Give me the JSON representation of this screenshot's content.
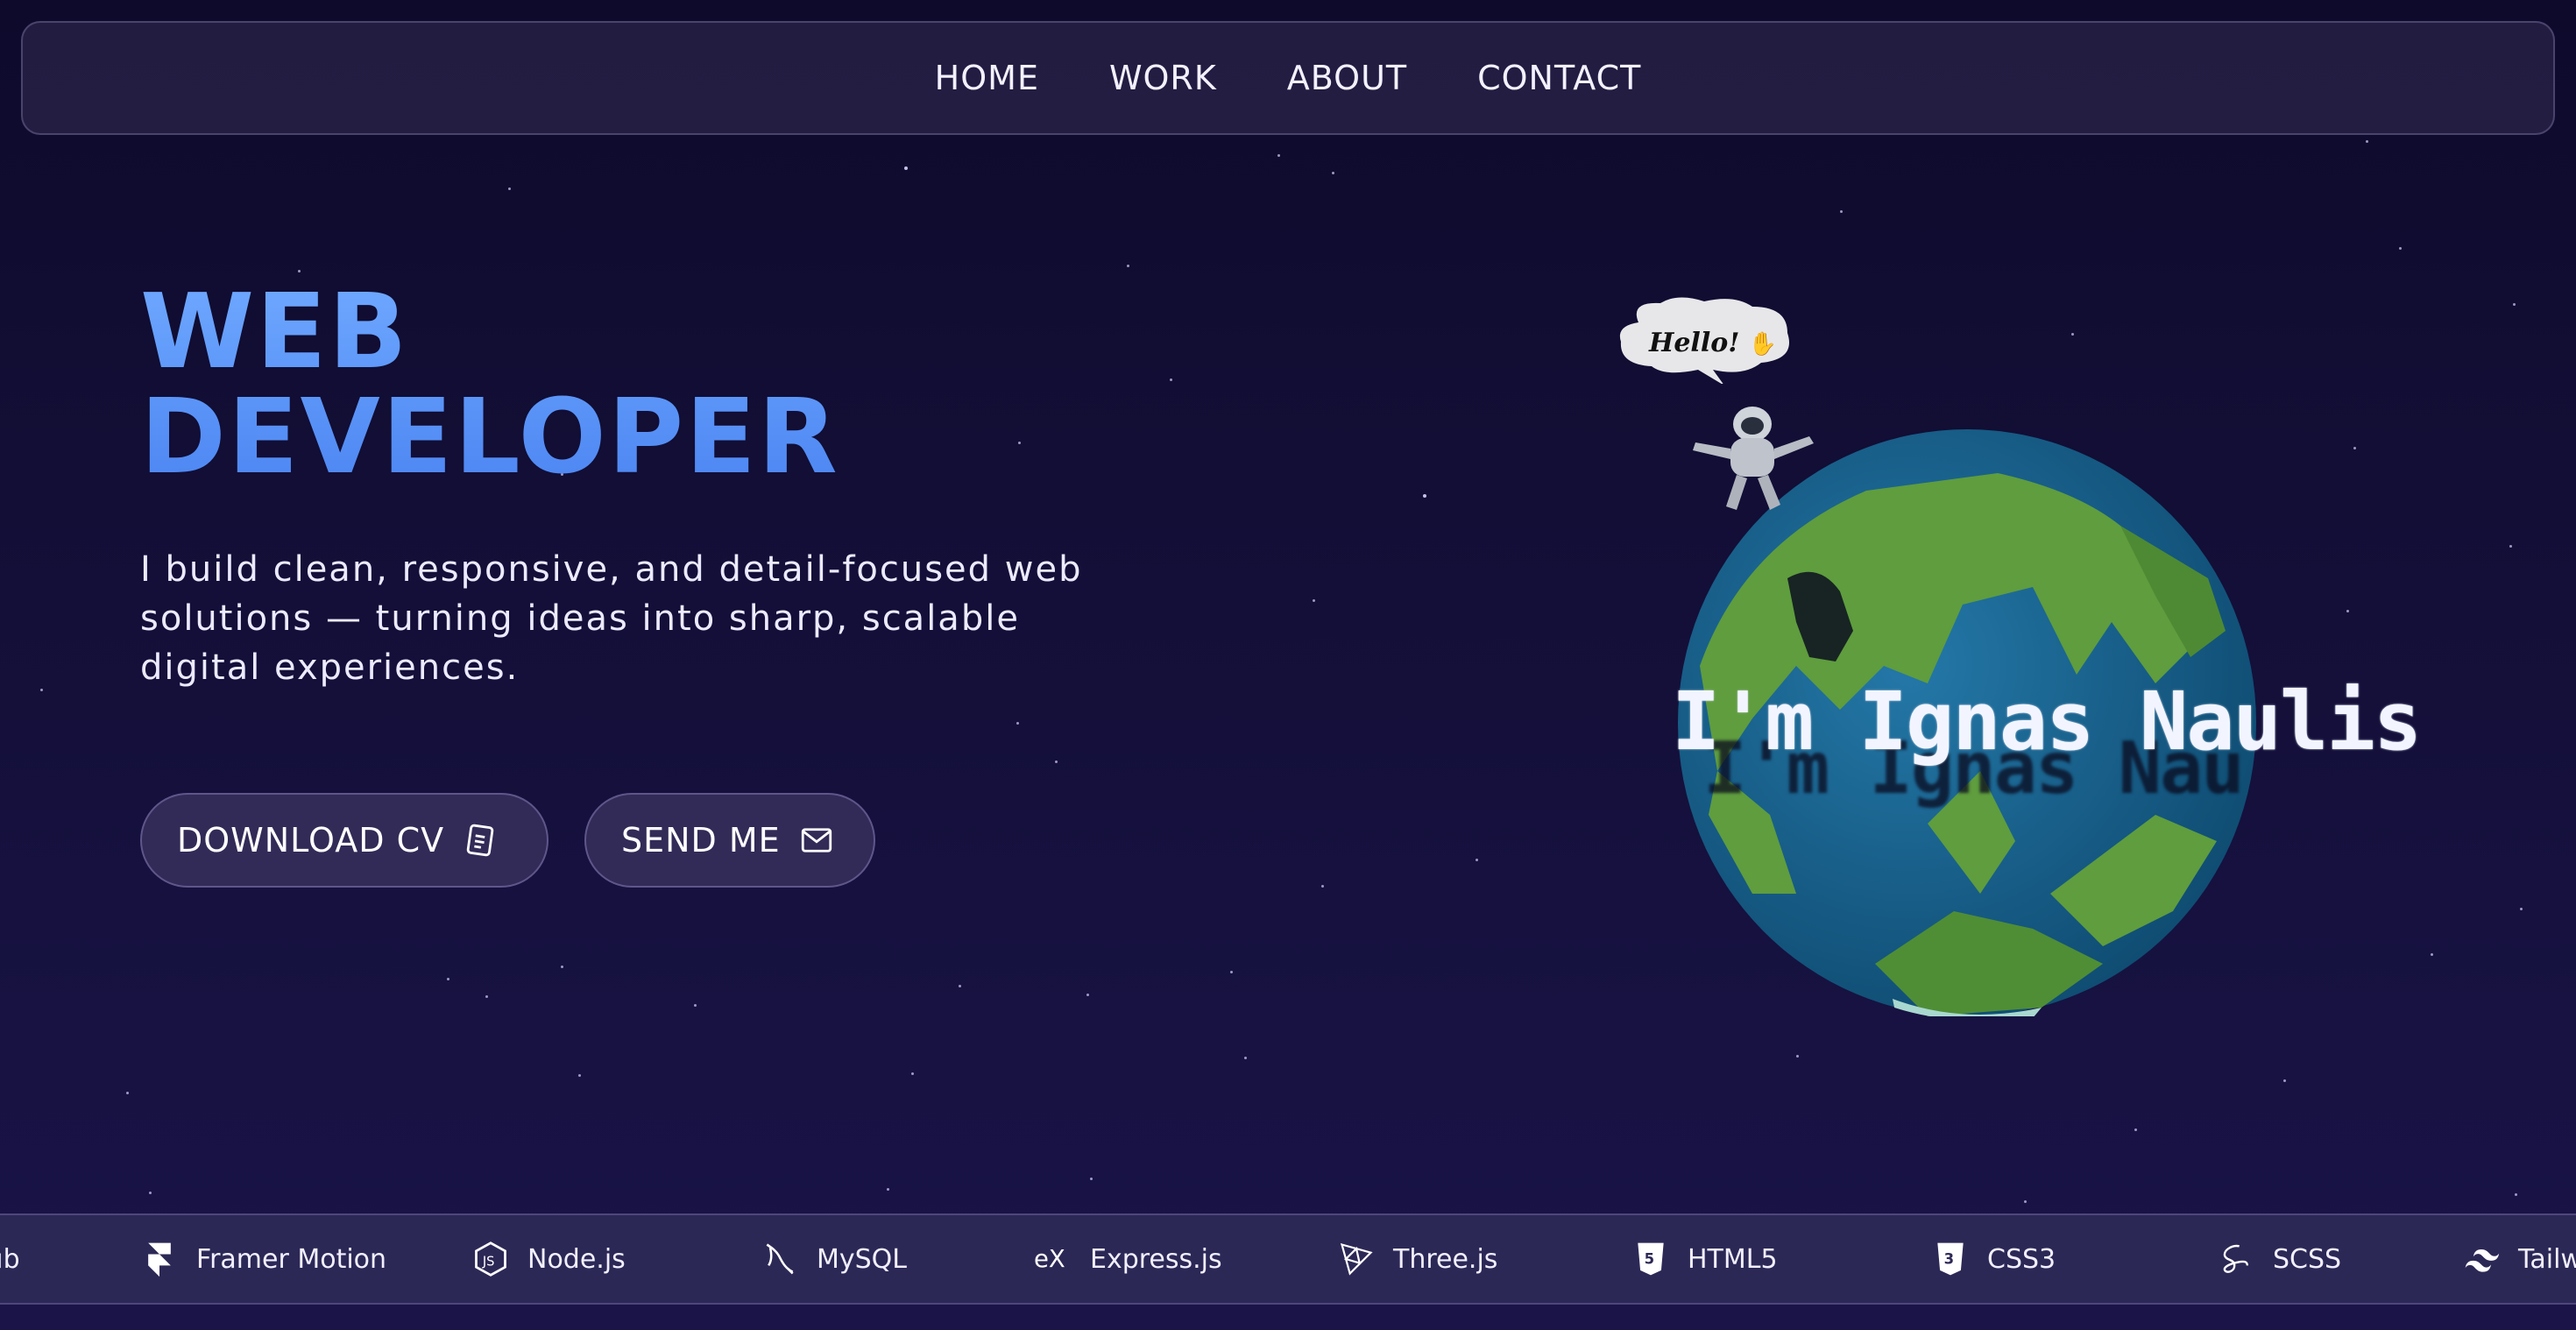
{
  "nav": {
    "items": [
      {
        "label": "HOME"
      },
      {
        "label": "WORK"
      },
      {
        "label": "ABOUT"
      },
      {
        "label": "CONTACT"
      }
    ]
  },
  "hero": {
    "title_line1": "WEB",
    "title_line2": "DEVELOPER",
    "description": "I build clean, responsive, and detail-focused web solutions — turning ideas into sharp, scalable digital experiences.",
    "buttons": {
      "download_cv": {
        "label": "DOWNLOAD CV",
        "icon": "document-icon"
      },
      "send_me": {
        "label": "SEND ME",
        "icon": "mail-icon"
      }
    }
  },
  "scene": {
    "speech_bubble": "Hello!",
    "speech_icon": "waving-hand-icon",
    "globe_text": "I'm Ignas Naulis"
  },
  "tech_ticker": {
    "items": [
      {
        "label": "Hub",
        "icon": "github-icon"
      },
      {
        "label": "Framer Motion",
        "icon": "framer-icon"
      },
      {
        "label": "Node.js",
        "icon": "nodejs-icon"
      },
      {
        "label": "MySQL",
        "icon": "mysql-dolphin-icon"
      },
      {
        "label": "Express.js",
        "icon": "express-icon"
      },
      {
        "label": "Three.js",
        "icon": "threejs-icon"
      },
      {
        "label": "HTML5",
        "icon": "html5-icon"
      },
      {
        "label": "CSS3",
        "icon": "css3-icon"
      },
      {
        "label": "SCSS",
        "icon": "sass-icon"
      },
      {
        "label": "Tailw",
        "icon": "tailwind-icon"
      }
    ]
  },
  "colors": {
    "background": "#130f38",
    "accent_blue": "#5b95fb",
    "ticker_bg": "#2c2856",
    "globe_ocean": "#1e6a9a",
    "globe_land": "#5f9d3e"
  }
}
